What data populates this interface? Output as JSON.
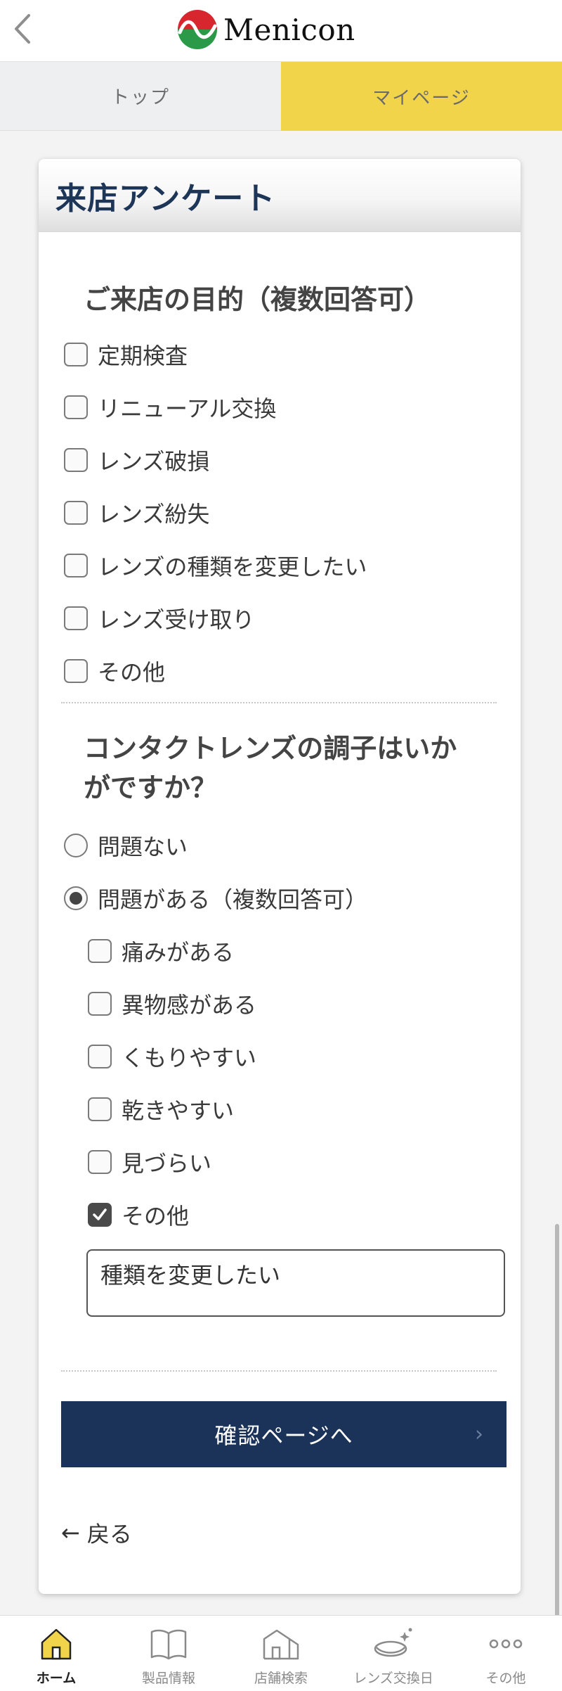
{
  "header": {
    "logo_text": "Menicon"
  },
  "tabs": [
    {
      "label": "トップ"
    },
    {
      "label": "マイページ"
    }
  ],
  "card": {
    "title": "来店アンケート"
  },
  "purpose": {
    "heading": "ご来店の目的（複数回答可）",
    "options": [
      {
        "label": "定期検査",
        "checked": false
      },
      {
        "label": "リニューアル交換",
        "checked": false
      },
      {
        "label": "レンズ破損",
        "checked": false
      },
      {
        "label": "レンズ紛失",
        "checked": false
      },
      {
        "label": "レンズの種類を変更したい",
        "checked": false
      },
      {
        "label": "レンズ受け取り",
        "checked": false
      },
      {
        "label": "その他",
        "checked": false
      }
    ]
  },
  "condition": {
    "heading_line1": "コンタクトレンズの調子はいか",
    "heading_line2": "がですか？",
    "radios": [
      {
        "label": "問題ない",
        "selected": false
      },
      {
        "label": "問題がある（複数回答可）",
        "selected": true
      }
    ],
    "issues": [
      {
        "label": "痛みがある",
        "checked": false
      },
      {
        "label": "異物感がある",
        "checked": false
      },
      {
        "label": "くもりやすい",
        "checked": false
      },
      {
        "label": "乾きやすい",
        "checked": false
      },
      {
        "label": "見づらい",
        "checked": false
      },
      {
        "label": "その他",
        "checked": true
      }
    ],
    "other_value": "種類を変更したい"
  },
  "actions": {
    "confirm_label": "確認ページへ",
    "back_label": "戻る"
  },
  "bottom_nav": [
    {
      "label": "ホーム",
      "icon": "home-icon",
      "active": true
    },
    {
      "label": "製品情報",
      "icon": "book-icon",
      "active": false
    },
    {
      "label": "店舗検索",
      "icon": "store-icon",
      "active": false
    },
    {
      "label": "レンズ交換日",
      "icon": "lens-case-icon",
      "active": false
    },
    {
      "label": "その他",
      "icon": "more-icon",
      "active": false
    }
  ],
  "colors": {
    "accent_yellow": "#f2d44b",
    "navy": "#1b3358",
    "title_navy": "#1d3557"
  }
}
